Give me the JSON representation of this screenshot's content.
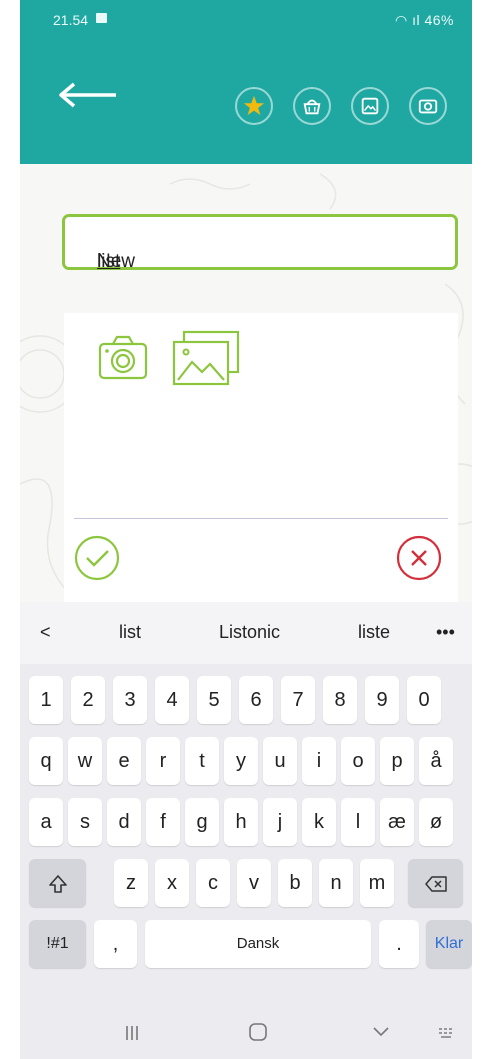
{
  "status": {
    "time": "21.54",
    "right": "46%"
  },
  "header": {
    "back_icon": "arrow-left-icon",
    "icons": [
      "star-icon",
      "basket-icon",
      "image-icon",
      "camera-icon"
    ],
    "accent": "#1fa8a2",
    "star_color": "#f2b90f"
  },
  "list_name": {
    "text_plain": "New ",
    "text_underlined": "list"
  },
  "card": {
    "colors": {
      "green": "#8cc63f",
      "red": "#d32f3a"
    }
  },
  "keyboard": {
    "suggestions": [
      "list",
      "Listonic",
      "liste"
    ],
    "rows": [
      [
        "1",
        "2",
        "3",
        "4",
        "5",
        "6",
        "7",
        "8",
        "9",
        "0"
      ],
      [
        "q",
        "w",
        "e",
        "r",
        "t",
        "y",
        "u",
        "i",
        "o",
        "p",
        "å"
      ],
      [
        "a",
        "s",
        "d",
        "f",
        "g",
        "h",
        "j",
        "k",
        "l",
        "æ",
        "ø"
      ],
      [
        "z",
        "x",
        "c",
        "v",
        "b",
        "n",
        "m"
      ]
    ],
    "symbols_label": "!#1",
    "comma": ",",
    "space_label": "Dansk",
    "period": ".",
    "enter_label": "Klar"
  }
}
